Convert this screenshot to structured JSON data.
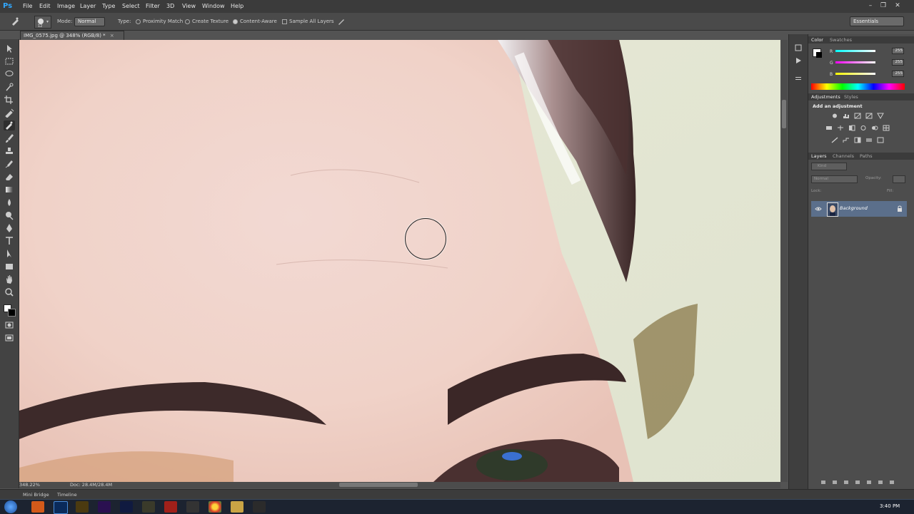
{
  "app": {
    "logo": "Ps",
    "brand_color": "#31a8ff"
  },
  "menu": [
    "File",
    "Edit",
    "Image",
    "Layer",
    "Type",
    "Select",
    "Filter",
    "3D",
    "View",
    "Window",
    "Help"
  ],
  "options": {
    "mode_label": "Mode:",
    "mode_value": "Normal",
    "type_label": "Type:",
    "proximity_match": "Proximity Match",
    "create_texture": "Create Texture",
    "content_aware": "Content-Aware",
    "sample_all_layers": "Sample All Layers",
    "selected_type": "Content-Aware",
    "workspace": "Essentials"
  },
  "document": {
    "tab_title": "IMG_0575.jpg @ 348% (RGB/8) *"
  },
  "status": {
    "zoom": "348.22%",
    "doc": "Doc: 28.4M/28.4M"
  },
  "bottom_tabs": [
    "Mini Bridge",
    "Timeline"
  ],
  "color_panel": {
    "tabs": [
      "Color",
      "Swatches"
    ],
    "channels": [
      {
        "label": "R",
        "value": "255"
      },
      {
        "label": "G",
        "value": "255"
      },
      {
        "label": "B",
        "value": "255"
      }
    ]
  },
  "adjustments_panel": {
    "tabs": [
      "Adjustments",
      "Styles"
    ],
    "heading": "Add an adjustment"
  },
  "layers_panel": {
    "tabs": [
      "Layers",
      "Channels",
      "Paths"
    ],
    "kind_label": "Kind",
    "blend_mode": "Normal",
    "opacity_label": "Opacity:",
    "lock_label": "Lock:",
    "fill_label": "Fill:",
    "layers": [
      {
        "name": "Background",
        "visible": true,
        "locked": true
      }
    ]
  },
  "taskbar": {
    "time": "3:40 PM"
  }
}
